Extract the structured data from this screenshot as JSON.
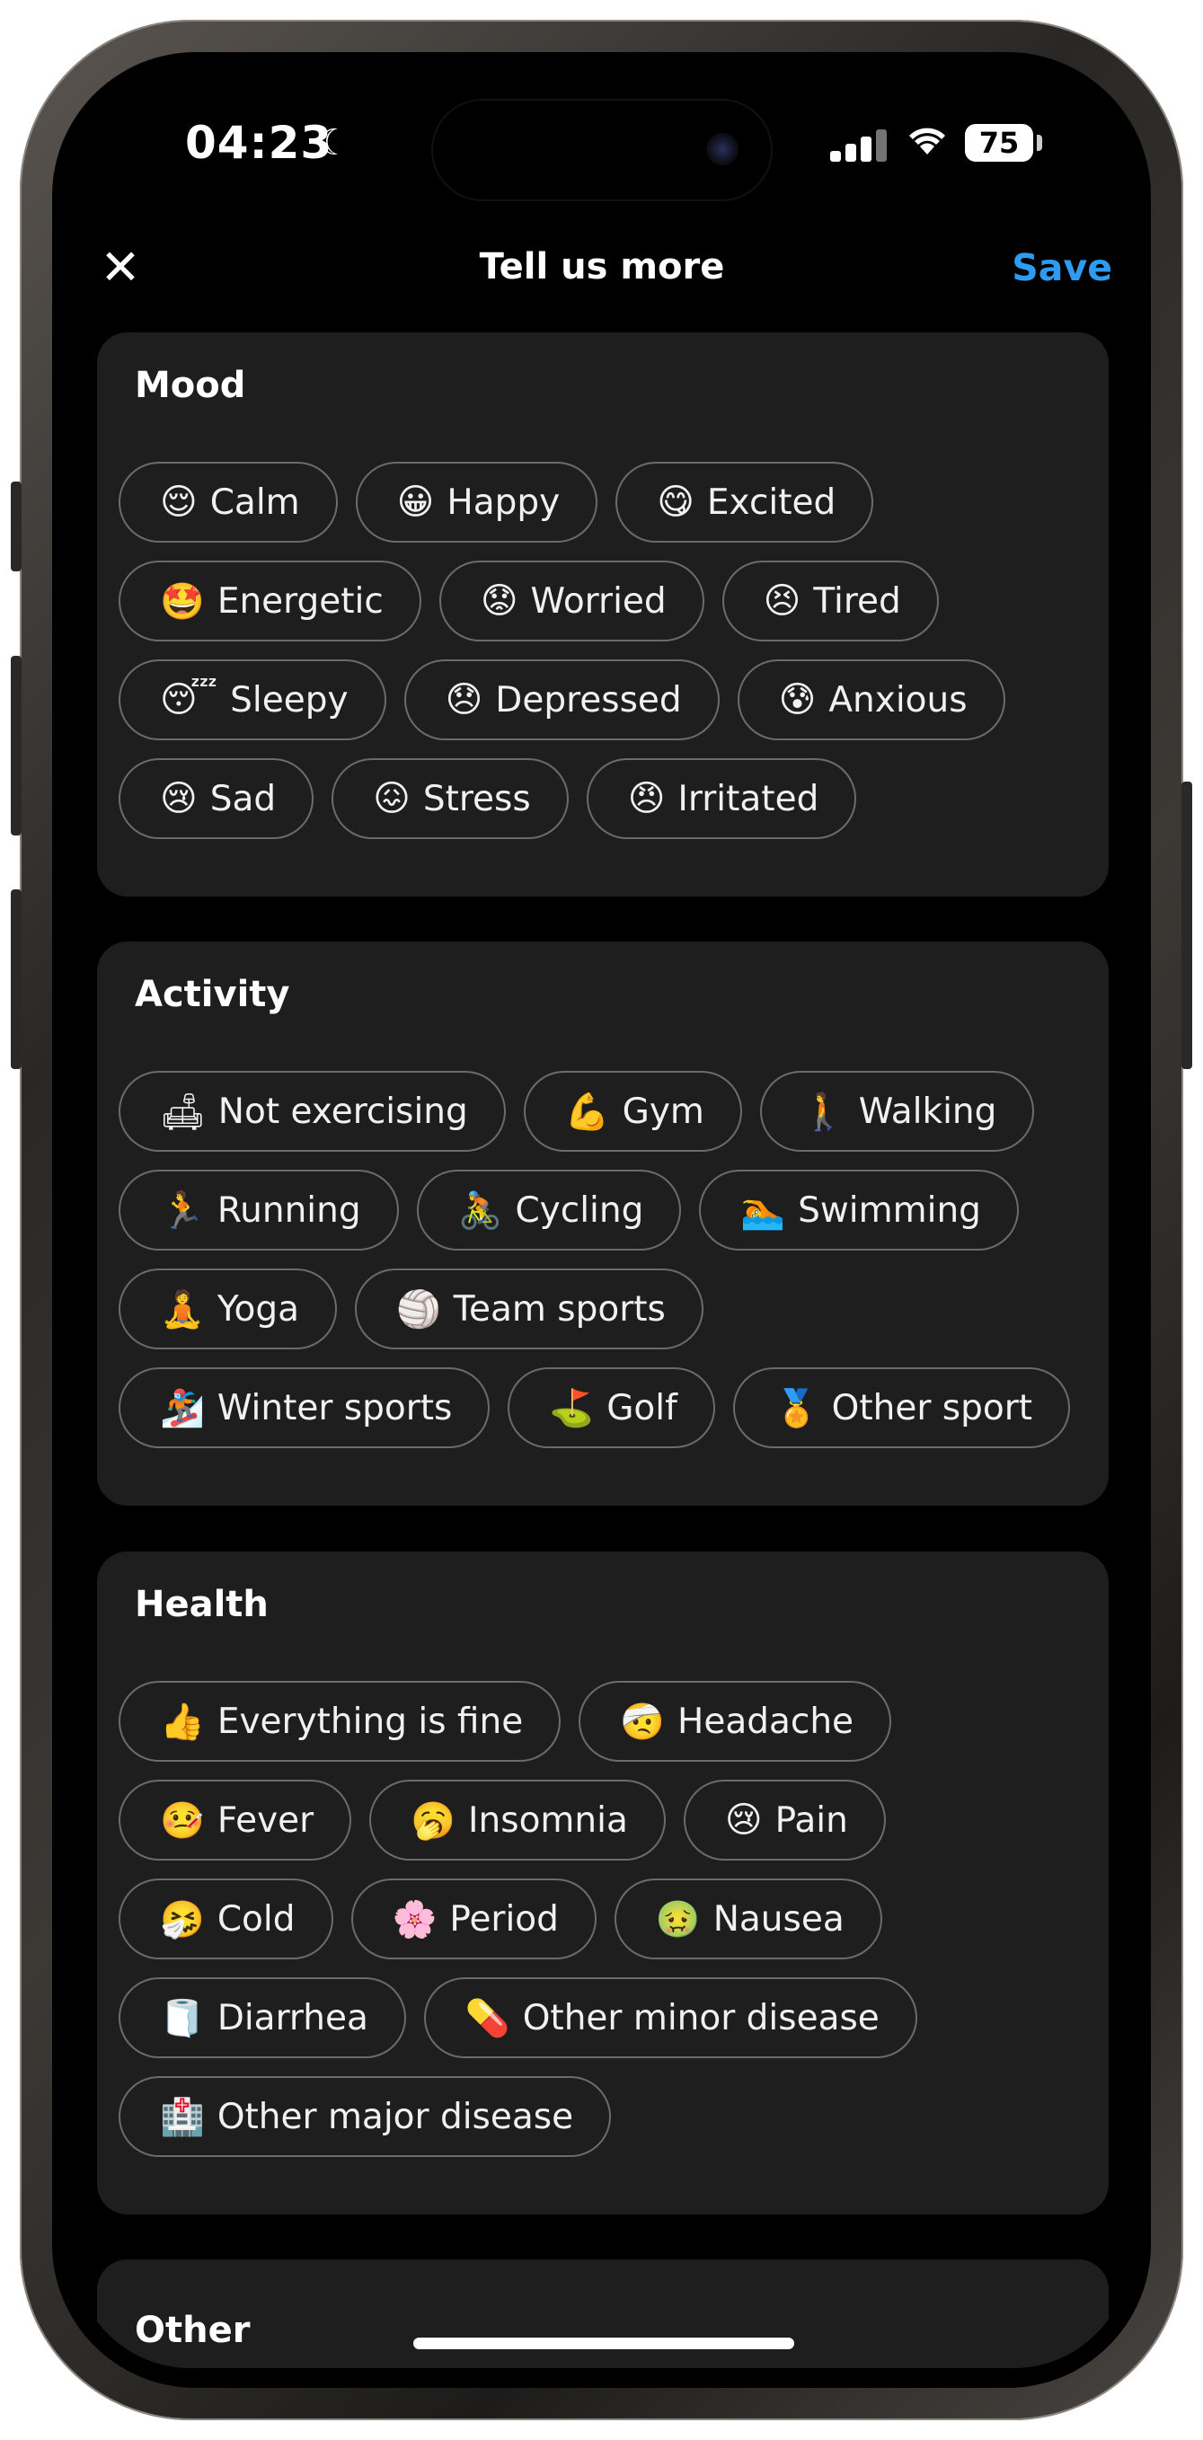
{
  "status": {
    "time": "04:23",
    "battery": "75"
  },
  "nav": {
    "close_glyph": "✕",
    "title": "Tell us more",
    "save": "Save"
  },
  "mood": {
    "title": "Mood",
    "rows": [
      [
        {
          "emoji": "😌",
          "label": "Calm"
        },
        {
          "emoji": "😀",
          "label": "Happy"
        },
        {
          "emoji": "😋",
          "label": "Excited"
        }
      ],
      [
        {
          "emoji": "🤩",
          "label": "Energetic"
        },
        {
          "emoji": "😟",
          "label": "Worried"
        },
        {
          "emoji": "😣",
          "label": "Tired"
        }
      ],
      [
        {
          "emoji": "😴",
          "label": "Sleepy"
        },
        {
          "emoji": "😞",
          "label": "Depressed"
        },
        {
          "emoji": "😰",
          "label": "Anxious"
        }
      ],
      [
        {
          "emoji": "😢",
          "label": "Sad"
        },
        {
          "emoji": "😖",
          "label": "Stress"
        },
        {
          "emoji": "😠",
          "label": "Irritated"
        }
      ]
    ]
  },
  "activity": {
    "title": "Activity",
    "rows": [
      [
        {
          "emoji": "🛋",
          "label": "Not exercising"
        },
        {
          "emoji": "💪",
          "label": "Gym"
        },
        {
          "emoji": "🚶",
          "label": "Walking"
        }
      ],
      [
        {
          "emoji": "🏃",
          "label": "Running"
        },
        {
          "emoji": "🚴",
          "label": "Cycling"
        },
        {
          "emoji": "🏊",
          "label": "Swimming"
        }
      ],
      [
        {
          "emoji": "🧘",
          "label": "Yoga"
        },
        {
          "emoji": "🏐",
          "label": "Team sports"
        }
      ],
      [
        {
          "emoji": "🏂",
          "label": "Winter sports"
        },
        {
          "emoji": "⛳",
          "label": "Golf"
        },
        {
          "emoji": "🏅",
          "label": "Other sport"
        }
      ]
    ]
  },
  "health": {
    "title": "Health",
    "rows": [
      [
        {
          "emoji": "👍",
          "label": "Everything is fine"
        },
        {
          "emoji": "🤕",
          "label": "Headache"
        }
      ],
      [
        {
          "emoji": "🤒",
          "label": "Fever"
        },
        {
          "emoji": "🥱",
          "label": "Insomnia"
        },
        {
          "emoji": "😢",
          "label": "Pain"
        }
      ],
      [
        {
          "emoji": "🤧",
          "label": "Cold"
        },
        {
          "emoji": "🌸",
          "label": "Period"
        },
        {
          "emoji": "🤢",
          "label": "Nausea"
        }
      ],
      [
        {
          "emoji": "🧻",
          "label": "Diarrhea"
        },
        {
          "emoji": "💊",
          "label": "Other minor disease"
        }
      ],
      [
        {
          "emoji": "🏥",
          "label": "Other major disease"
        }
      ]
    ]
  },
  "other": {
    "title": "Other"
  }
}
